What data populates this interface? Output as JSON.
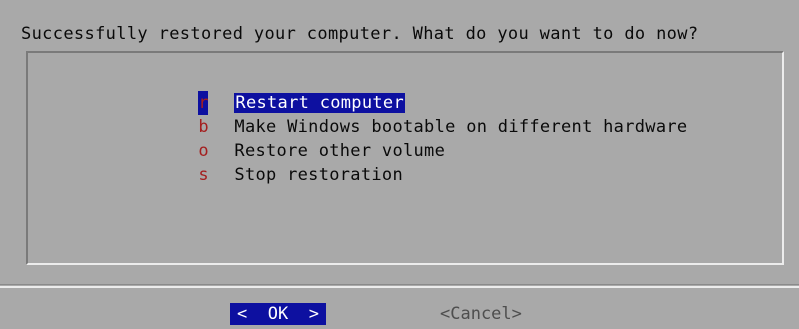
{
  "dialog": {
    "prompt": "Successfully restored your computer. What do you want to do now?"
  },
  "menu": {
    "items": [
      {
        "key": "r",
        "label": "Restart computer",
        "selected": true
      },
      {
        "key": "b",
        "label": "Make Windows bootable on different hardware",
        "selected": false
      },
      {
        "key": "o",
        "label": "Restore other volume",
        "selected": false
      },
      {
        "key": "s",
        "label": "Stop restoration",
        "selected": false
      }
    ]
  },
  "buttons": {
    "ok_label": "<  OK  >",
    "cancel_label": "<Cancel>"
  },
  "colors": {
    "background": "#a9a9a9",
    "highlight": "#0d10a0",
    "hotkey": "#a41f1f",
    "text": "#0a0a0a"
  }
}
